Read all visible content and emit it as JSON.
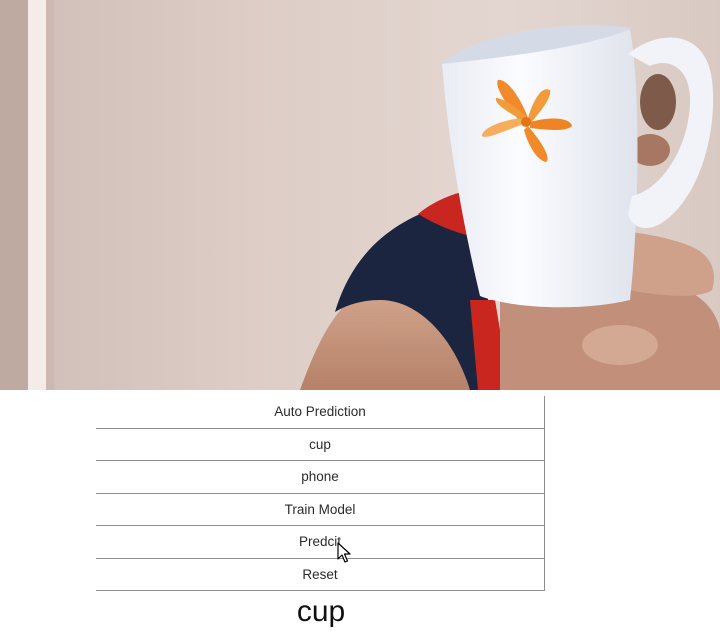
{
  "controls": {
    "auto_prediction_label": "Auto Prediction",
    "cup_label": "cup",
    "phone_label": "phone",
    "train_model_label": "Train Model",
    "predict_label": "Predcit",
    "reset_label": "Reset"
  },
  "result": {
    "prediction_text": "cup"
  },
  "webcam": {
    "subject": "hand holding white mug with orange flower"
  },
  "colors": {
    "wall": "#d9c8c1",
    "mug": "#f4f6fb",
    "flower": "#f08a2a",
    "shirt_navy": "#1c2540",
    "shirt_red": "#c8261e",
    "skin": "#c99a82"
  }
}
